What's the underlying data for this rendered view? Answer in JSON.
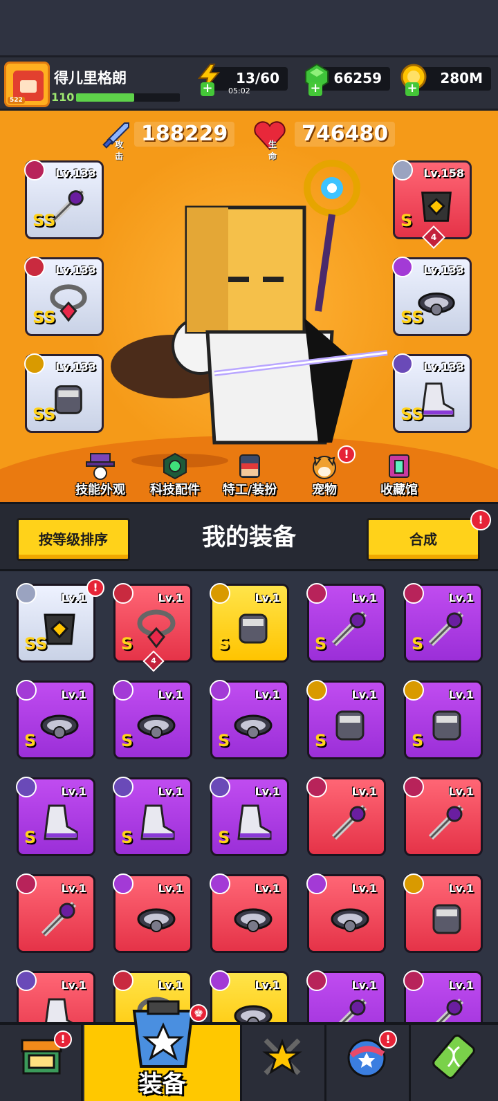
{
  "player": {
    "name": "得儿里格朗",
    "level": "110",
    "badge_level": "522",
    "xp_fraction": 0.56
  },
  "resources": {
    "energy": {
      "value": "13/60",
      "timer": "05:02",
      "icon": "lightning-icon"
    },
    "gems": {
      "value": "66259",
      "icon": "green-gem-icon"
    },
    "coins": {
      "value": "280M",
      "icon": "gold-coin-icon"
    }
  },
  "stats": {
    "attack": {
      "label": "攻击",
      "value": "188229",
      "icon": "sword-icon"
    },
    "health": {
      "label": "生命",
      "value": "746480",
      "icon": "heart-icon"
    }
  },
  "equipped": {
    "left": [
      {
        "level": "Lv.133",
        "rank": "SS",
        "category": "weapon",
        "item": "staff-icon"
      },
      {
        "level": "Lv.133",
        "rank": "SS",
        "category": "necklace",
        "item": "necklace-icon"
      },
      {
        "level": "Lv.133",
        "rank": "SS",
        "category": "glove",
        "item": "glove-icon"
      }
    ],
    "right": [
      {
        "level": "Lv.158",
        "rank": "S",
        "category": "armor",
        "item": "armor-icon",
        "stars": "4"
      },
      {
        "level": "Lv.133",
        "rank": "SS",
        "category": "belt",
        "item": "belt-icon"
      },
      {
        "level": "Lv.133",
        "rank": "SS",
        "category": "boots",
        "item": "boots-icon"
      }
    ]
  },
  "hero_menu": [
    {
      "label": "技能外观",
      "icon": "skill-skin-icon"
    },
    {
      "label": "科技配件",
      "icon": "tech-part-icon"
    },
    {
      "label": "特工/装扮",
      "icon": "agent-icon"
    },
    {
      "label": "宠物",
      "icon": "pet-icon",
      "badge": "!"
    },
    {
      "label": "收藏馆",
      "icon": "collection-icon"
    }
  ],
  "toolbar": {
    "sort_label": "按等级排序",
    "title": "我的装备",
    "merge_label": "合成",
    "merge_badge": "!"
  },
  "inventory": [
    {
      "level": "Lv.1",
      "rank": "SS",
      "quality": "white",
      "category": "armor",
      "badge": "!"
    },
    {
      "level": "Lv.1",
      "rank": "S",
      "quality": "red",
      "category": "necklace",
      "stars": "4"
    },
    {
      "level": "Lv.1",
      "rank": "S",
      "quality": "yellow",
      "category": "glove"
    },
    {
      "level": "Lv.1",
      "rank": "S",
      "quality": "purple",
      "category": "weapon"
    },
    {
      "level": "Lv.1",
      "rank": "S",
      "quality": "purple",
      "category": "weapon"
    },
    {
      "level": "Lv.1",
      "rank": "S",
      "quality": "purple",
      "category": "belt"
    },
    {
      "level": "Lv.1",
      "rank": "S",
      "quality": "purple",
      "category": "belt"
    },
    {
      "level": "Lv.1",
      "rank": "S",
      "quality": "purple",
      "category": "belt"
    },
    {
      "level": "Lv.1",
      "rank": "S",
      "quality": "purple",
      "category": "glove"
    },
    {
      "level": "Lv.1",
      "rank": "S",
      "quality": "purple",
      "category": "glove"
    },
    {
      "level": "Lv.1",
      "rank": "S",
      "quality": "purple",
      "category": "boots"
    },
    {
      "level": "Lv.1",
      "rank": "S",
      "quality": "purple",
      "category": "boots"
    },
    {
      "level": "Lv.1",
      "rank": "S",
      "quality": "purple",
      "category": "boots"
    },
    {
      "level": "Lv.1",
      "rank": "",
      "quality": "red",
      "category": "weapon"
    },
    {
      "level": "Lv.1",
      "rank": "",
      "quality": "red",
      "category": "weapon"
    },
    {
      "level": "Lv.1",
      "rank": "",
      "quality": "red",
      "category": "weapon"
    },
    {
      "level": "Lv.1",
      "rank": "",
      "quality": "red",
      "category": "belt"
    },
    {
      "level": "Lv.1",
      "rank": "",
      "quality": "red",
      "category": "belt"
    },
    {
      "level": "Lv.1",
      "rank": "",
      "quality": "red",
      "category": "belt"
    },
    {
      "level": "Lv.1",
      "rank": "",
      "quality": "red",
      "category": "glove"
    },
    {
      "level": "Lv.1",
      "rank": "",
      "quality": "red",
      "category": "boots"
    },
    {
      "level": "Lv.1",
      "rank": "",
      "quality": "yellow",
      "category": "necklace"
    },
    {
      "level": "Lv.1",
      "rank": "",
      "quality": "yellow",
      "category": "belt"
    },
    {
      "level": "Lv.1",
      "rank": "",
      "quality": "purple",
      "category": "weapon"
    },
    {
      "level": "Lv.1",
      "rank": "",
      "quality": "purple",
      "category": "weapon"
    }
  ],
  "bottom_nav": [
    {
      "label": "",
      "icon": "shop-icon",
      "badge": "!"
    },
    {
      "label": "装备",
      "icon": "equipment-icon",
      "active": true
    },
    {
      "label": "",
      "icon": "battle-icon"
    },
    {
      "label": "",
      "icon": "planet-icon",
      "badge": "!"
    },
    {
      "label": "",
      "icon": "dna-icon"
    }
  ],
  "colors": {
    "accent": "#ffd21a",
    "hero_bg": "#f59a18",
    "badge": "#e62337"
  }
}
